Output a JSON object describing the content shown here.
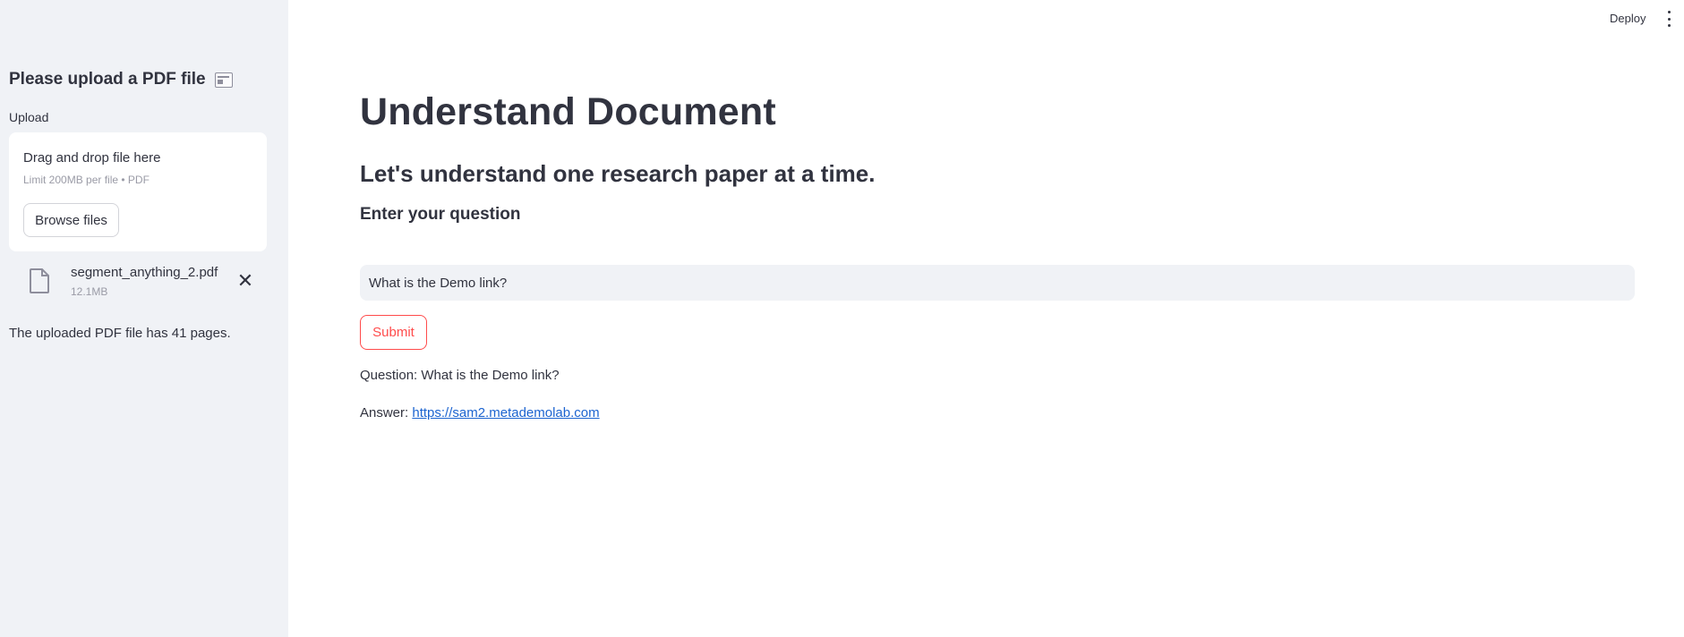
{
  "topbar": {
    "deploy_label": "Deploy",
    "menu_icon": "more-vertical-icon"
  },
  "sidebar": {
    "header": "Please upload a PDF file",
    "header_icon": "newspaper-icon",
    "upload_label": "Upload",
    "dropzone": {
      "title": "Drag and drop file here",
      "limit": "Limit 200MB per file • PDF",
      "browse_label": "Browse files"
    },
    "uploaded_file": {
      "name": "segment_anything_2.pdf",
      "size": "12.1MB",
      "icon": "file-icon",
      "remove_icon": "close-icon"
    },
    "pages_info": "The uploaded PDF file has 41 pages."
  },
  "main": {
    "title": "Understand Document",
    "subtitle": "Let's understand one research paper at a time.",
    "question_label": "Enter your question",
    "question_input_value": "What is the Demo link?",
    "submit_label": "Submit",
    "result": {
      "question_prefix": "Question:",
      "question_text": "What is the Demo link?",
      "answer_prefix": "Answer:",
      "answer_link": "https://sam2.metademolab.com"
    }
  },
  "colors": {
    "sidebar_bg": "#f0f2f6",
    "text": "#31333f",
    "accent": "#ff4b4b",
    "link": "#1c64d0"
  }
}
